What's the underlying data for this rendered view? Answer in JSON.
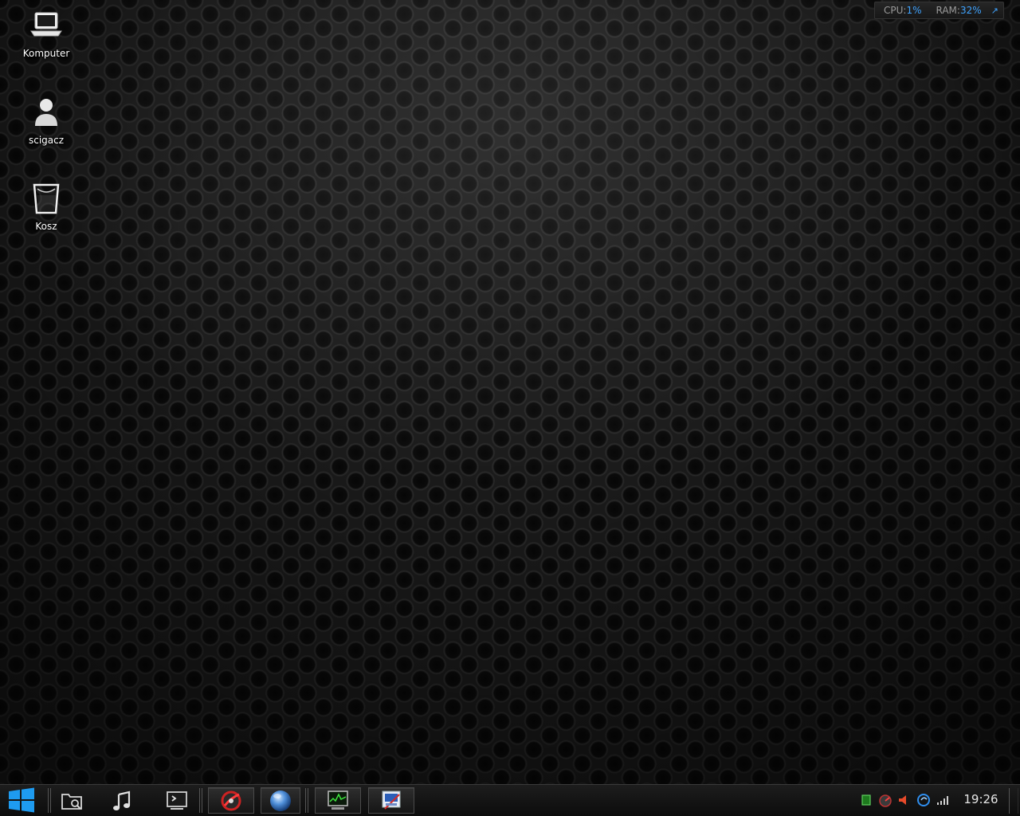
{
  "desktop": {
    "icons": [
      {
        "label": "Komputer",
        "icon": "laptop-icon"
      },
      {
        "label": "scigacz",
        "icon": "user-icon"
      },
      {
        "label": "Kosz",
        "icon": "trash-icon"
      }
    ]
  },
  "sysmon": {
    "cpu_label": "CPU:",
    "cpu_value": "1%",
    "ram_label": "RAM:",
    "ram_value": "32%",
    "arrow": "↗"
  },
  "taskbar": {
    "start_icon": "windows-logo-icon",
    "quicklaunch": [
      {
        "icon": "file-manager-icon"
      },
      {
        "icon": "music-icon"
      },
      {
        "icon": "terminal-icon"
      }
    ],
    "tasks": [
      {
        "icon": "media-player-red-icon"
      },
      {
        "icon": "globe-browser-icon"
      },
      {
        "icon": "system-monitor-icon"
      },
      {
        "icon": "screenshot-tool-icon"
      }
    ],
    "tray": [
      {
        "icon": "green-square-icon"
      },
      {
        "icon": "speedometer-icon"
      },
      {
        "icon": "volume-muted-icon"
      },
      {
        "icon": "update-icon"
      },
      {
        "icon": "network-signal-icon"
      }
    ],
    "clock": "19:26"
  },
  "colors": {
    "accent": "#3fa3ff",
    "start_blue": "#1e9bf0"
  }
}
